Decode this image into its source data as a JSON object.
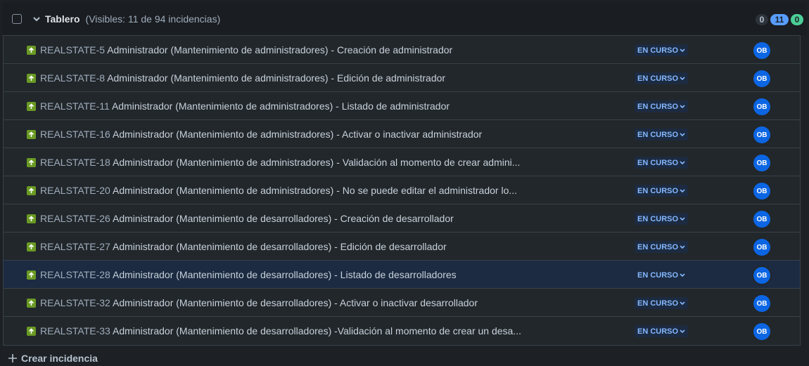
{
  "header": {
    "title": "Tablero",
    "count_text": "(Visibles: 11 de 94 incidencias)",
    "pill_todo": "0",
    "pill_inprogress": "11",
    "pill_done": "0"
  },
  "rows": [
    {
      "key": "REALSTATE-5",
      "summary": "Administrador (Mantenimiento de administradores) - Creación de administrador",
      "status": "EN CURSO",
      "assignee": "OB"
    },
    {
      "key": "REALSTATE-8",
      "summary": "Administrador (Mantenimiento de administradores) - Edición de administrador",
      "status": "EN CURSO",
      "assignee": "OB"
    },
    {
      "key": "REALSTATE-11",
      "summary": "Administrador (Mantenimiento de administradores) - Listado de administrador",
      "status": "EN CURSO",
      "assignee": "OB"
    },
    {
      "key": "REALSTATE-16",
      "summary": "Administrador (Mantenimiento de administradores) - Activar o inactivar administrador",
      "status": "EN CURSO",
      "assignee": "OB"
    },
    {
      "key": "REALSTATE-18",
      "summary": "Administrador (Mantenimiento de administradores) - Validación al momento de crear admini...",
      "status": "EN CURSO",
      "assignee": "OB"
    },
    {
      "key": "REALSTATE-20",
      "summary": "Administrador (Mantenimiento de administradores) - No se puede editar el administrador lo...",
      "status": "EN CURSO",
      "assignee": "OB"
    },
    {
      "key": "REALSTATE-26",
      "summary": "Administrador (Mantenimiento de desarrolladores) - Creación de desarrollador",
      "status": "EN CURSO",
      "assignee": "OB"
    },
    {
      "key": "REALSTATE-27",
      "summary": "Administrador (Mantenimiento de desarrolladores) - Edición de desarrollador",
      "status": "EN CURSO",
      "assignee": "OB"
    },
    {
      "key": "REALSTATE-28",
      "summary": "Administrador (Mantenimiento de desarrolladores) - Listado de desarrolladores",
      "status": "EN CURSO",
      "assignee": "OB"
    },
    {
      "key": "REALSTATE-32",
      "summary": "Administrador (Mantenimiento de desarrolladores) - Activar o inactivar desarrollador",
      "status": "EN CURSO",
      "assignee": "OB"
    },
    {
      "key": "REALSTATE-33",
      "summary": "Administrador (Mantenimiento de desarrolladores) -Validación al momento de crear un desa...",
      "status": "EN CURSO",
      "assignee": "OB"
    }
  ],
  "selected_row": "REALSTATE-28",
  "footer": {
    "create_label": "Crear incidencia"
  },
  "colors": {
    "story_icon": "#6a9a23",
    "status_text": "#85b8ff",
    "avatar": "#0c66e4"
  }
}
